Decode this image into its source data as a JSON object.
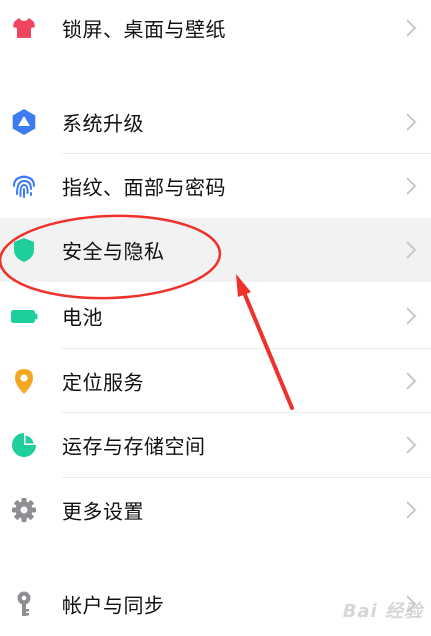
{
  "settings": {
    "items": [
      {
        "label": "锁屏、桌面与壁纸",
        "icon": "shirt-icon",
        "color": "#f2445c"
      },
      {
        "label": "系统升级",
        "icon": "system-update-icon",
        "color": "#3c7bf1"
      },
      {
        "label": "指纹、面部与密码",
        "icon": "fingerprint-icon",
        "color": "#3c7bf1"
      },
      {
        "label": "安全与隐私",
        "icon": "shield-icon",
        "color": "#1fcf9b"
      },
      {
        "label": "电池",
        "icon": "battery-icon",
        "color": "#1fcf9b"
      },
      {
        "label": "定位服务",
        "icon": "location-pin-icon",
        "color": "#f5a623"
      },
      {
        "label": "运存与存储空间",
        "icon": "storage-pie-icon",
        "color": "#1fcf9b"
      },
      {
        "label": "更多设置",
        "icon": "gear-icon",
        "color": "#8e8e93"
      },
      {
        "label": "帐户与同步",
        "icon": "key-icon",
        "color": "#8e8e93"
      }
    ]
  },
  "annotation": {
    "color": "#f0302a",
    "highlighted_item": "安全与隐私"
  },
  "watermark": {
    "text": "Bai 经验"
  }
}
